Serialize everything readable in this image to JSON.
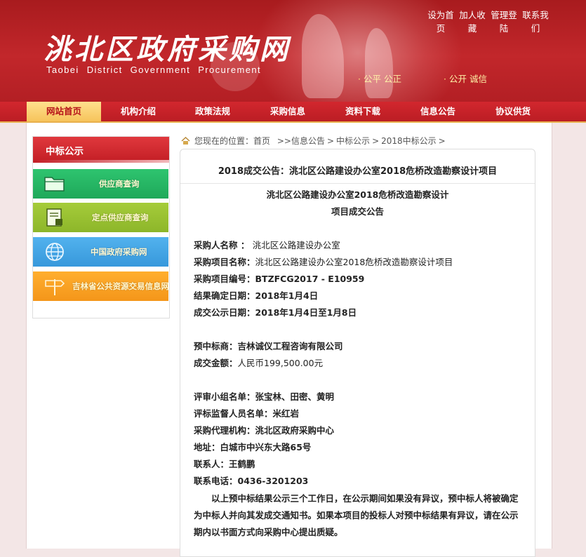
{
  "header": {
    "logo_cn": "洮北区政府采购网",
    "logo_en": "Taobei District Government Procurement",
    "toplinks": [
      "设为首页",
      "加人收藏",
      "管理登陆",
      "联系我们"
    ],
    "slogan_1": "公平   公正",
    "slogan_2": "公开   诚信"
  },
  "nav": [
    "网站首页",
    "机构介绍",
    "政策法规",
    "采购信息",
    "资料下载",
    "信息公告",
    "协议供货"
  ],
  "sidebar": {
    "title": "中标公示",
    "tiles": [
      "供应商查询",
      "定点供应商查询",
      "中国政府采购网",
      "吉林省公共资源交易信息网"
    ]
  },
  "breadcrumb": {
    "prefix": "您现在的位置：",
    "items": [
      "首页",
      ">>信息公告",
      "中标公示",
      "2018中标公示"
    ]
  },
  "article": {
    "title": "2018成交公告：洮北区公路建设办公室2018危桥改造勘察设计项目",
    "subtitle_1": "洮北区公路建设办公室2018危桥改造勘察设计",
    "subtitle_2": "项目成交公告",
    "fields": [
      {
        "label": "采购人名称 ： ",
        "value": "洮北区公路建设办公室"
      },
      {
        "label": "采购项目名称：",
        "value": "洮北区公路建设办公室2018危桥改造勘察设计项目"
      },
      {
        "label": "采购项目编号：",
        "value": "BTZFCG2017 - E10959"
      },
      {
        "label": "结果确定日期：",
        "value": "2018年1月4日"
      },
      {
        "label": "成交公示日期：",
        "value": "2018年1月4日至1月8日"
      },
      {
        "label": "预中标商：",
        "value": "吉林诚仪工程咨询有限公司"
      },
      {
        "label": "成交金额：",
        "value": "人民币199,500.00元"
      },
      {
        "label": "评审小组名单：",
        "value": "张宝林、田密、黄明"
      },
      {
        "label": "评标监督人员名单：",
        "value": "米红岩"
      },
      {
        "label": "采购代理机构：",
        "value": "洮北区政府采购中心"
      },
      {
        "label": "地址：",
        "value": "白城市中兴东大路65号"
      },
      {
        "label": "联系人：",
        "value": "王鹤鹏"
      },
      {
        "label": "联系电话：",
        "value": "0436-3201203"
      }
    ],
    "notice": "以上预中标结果公示三个工作日，在公示期间如果没有异议，预中标人将被确定为中标人并向其发成交通知书。如果本项目的投标人对预中标结果有异议，请在公示期内以书面方式向采购中心提出质疑。"
  }
}
